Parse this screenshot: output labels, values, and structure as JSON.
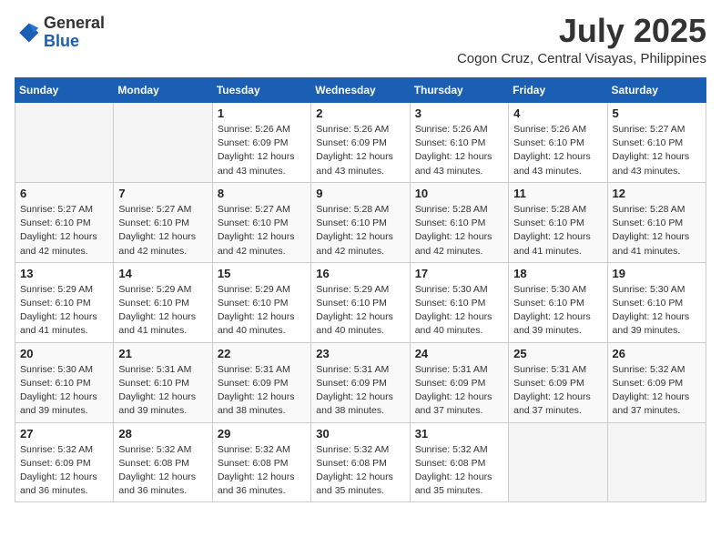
{
  "header": {
    "logo_line1": "General",
    "logo_line2": "Blue",
    "month_title": "July 2025",
    "location": "Cogon Cruz, Central Visayas, Philippines"
  },
  "days_of_week": [
    "Sunday",
    "Monday",
    "Tuesday",
    "Wednesday",
    "Thursday",
    "Friday",
    "Saturday"
  ],
  "weeks": [
    [
      {
        "day": "",
        "sunrise": "",
        "sunset": "",
        "daylight": "",
        "empty": true
      },
      {
        "day": "",
        "sunrise": "",
        "sunset": "",
        "daylight": "",
        "empty": true
      },
      {
        "day": "1",
        "sunrise": "Sunrise: 5:26 AM",
        "sunset": "Sunset: 6:09 PM",
        "daylight": "Daylight: 12 hours and 43 minutes."
      },
      {
        "day": "2",
        "sunrise": "Sunrise: 5:26 AM",
        "sunset": "Sunset: 6:09 PM",
        "daylight": "Daylight: 12 hours and 43 minutes."
      },
      {
        "day": "3",
        "sunrise": "Sunrise: 5:26 AM",
        "sunset": "Sunset: 6:10 PM",
        "daylight": "Daylight: 12 hours and 43 minutes."
      },
      {
        "day": "4",
        "sunrise": "Sunrise: 5:26 AM",
        "sunset": "Sunset: 6:10 PM",
        "daylight": "Daylight: 12 hours and 43 minutes."
      },
      {
        "day": "5",
        "sunrise": "Sunrise: 5:27 AM",
        "sunset": "Sunset: 6:10 PM",
        "daylight": "Daylight: 12 hours and 43 minutes."
      }
    ],
    [
      {
        "day": "6",
        "sunrise": "Sunrise: 5:27 AM",
        "sunset": "Sunset: 6:10 PM",
        "daylight": "Daylight: 12 hours and 42 minutes."
      },
      {
        "day": "7",
        "sunrise": "Sunrise: 5:27 AM",
        "sunset": "Sunset: 6:10 PM",
        "daylight": "Daylight: 12 hours and 42 minutes."
      },
      {
        "day": "8",
        "sunrise": "Sunrise: 5:27 AM",
        "sunset": "Sunset: 6:10 PM",
        "daylight": "Daylight: 12 hours and 42 minutes."
      },
      {
        "day": "9",
        "sunrise": "Sunrise: 5:28 AM",
        "sunset": "Sunset: 6:10 PM",
        "daylight": "Daylight: 12 hours and 42 minutes."
      },
      {
        "day": "10",
        "sunrise": "Sunrise: 5:28 AM",
        "sunset": "Sunset: 6:10 PM",
        "daylight": "Daylight: 12 hours and 42 minutes."
      },
      {
        "day": "11",
        "sunrise": "Sunrise: 5:28 AM",
        "sunset": "Sunset: 6:10 PM",
        "daylight": "Daylight: 12 hours and 41 minutes."
      },
      {
        "day": "12",
        "sunrise": "Sunrise: 5:28 AM",
        "sunset": "Sunset: 6:10 PM",
        "daylight": "Daylight: 12 hours and 41 minutes."
      }
    ],
    [
      {
        "day": "13",
        "sunrise": "Sunrise: 5:29 AM",
        "sunset": "Sunset: 6:10 PM",
        "daylight": "Daylight: 12 hours and 41 minutes."
      },
      {
        "day": "14",
        "sunrise": "Sunrise: 5:29 AM",
        "sunset": "Sunset: 6:10 PM",
        "daylight": "Daylight: 12 hours and 41 minutes."
      },
      {
        "day": "15",
        "sunrise": "Sunrise: 5:29 AM",
        "sunset": "Sunset: 6:10 PM",
        "daylight": "Daylight: 12 hours and 40 minutes."
      },
      {
        "day": "16",
        "sunrise": "Sunrise: 5:29 AM",
        "sunset": "Sunset: 6:10 PM",
        "daylight": "Daylight: 12 hours and 40 minutes."
      },
      {
        "day": "17",
        "sunrise": "Sunrise: 5:30 AM",
        "sunset": "Sunset: 6:10 PM",
        "daylight": "Daylight: 12 hours and 40 minutes."
      },
      {
        "day": "18",
        "sunrise": "Sunrise: 5:30 AM",
        "sunset": "Sunset: 6:10 PM",
        "daylight": "Daylight: 12 hours and 39 minutes."
      },
      {
        "day": "19",
        "sunrise": "Sunrise: 5:30 AM",
        "sunset": "Sunset: 6:10 PM",
        "daylight": "Daylight: 12 hours and 39 minutes."
      }
    ],
    [
      {
        "day": "20",
        "sunrise": "Sunrise: 5:30 AM",
        "sunset": "Sunset: 6:10 PM",
        "daylight": "Daylight: 12 hours and 39 minutes."
      },
      {
        "day": "21",
        "sunrise": "Sunrise: 5:31 AM",
        "sunset": "Sunset: 6:10 PM",
        "daylight": "Daylight: 12 hours and 39 minutes."
      },
      {
        "day": "22",
        "sunrise": "Sunrise: 5:31 AM",
        "sunset": "Sunset: 6:09 PM",
        "daylight": "Daylight: 12 hours and 38 minutes."
      },
      {
        "day": "23",
        "sunrise": "Sunrise: 5:31 AM",
        "sunset": "Sunset: 6:09 PM",
        "daylight": "Daylight: 12 hours and 38 minutes."
      },
      {
        "day": "24",
        "sunrise": "Sunrise: 5:31 AM",
        "sunset": "Sunset: 6:09 PM",
        "daylight": "Daylight: 12 hours and 37 minutes."
      },
      {
        "day": "25",
        "sunrise": "Sunrise: 5:31 AM",
        "sunset": "Sunset: 6:09 PM",
        "daylight": "Daylight: 12 hours and 37 minutes."
      },
      {
        "day": "26",
        "sunrise": "Sunrise: 5:32 AM",
        "sunset": "Sunset: 6:09 PM",
        "daylight": "Daylight: 12 hours and 37 minutes."
      }
    ],
    [
      {
        "day": "27",
        "sunrise": "Sunrise: 5:32 AM",
        "sunset": "Sunset: 6:09 PM",
        "daylight": "Daylight: 12 hours and 36 minutes."
      },
      {
        "day": "28",
        "sunrise": "Sunrise: 5:32 AM",
        "sunset": "Sunset: 6:08 PM",
        "daylight": "Daylight: 12 hours and 36 minutes."
      },
      {
        "day": "29",
        "sunrise": "Sunrise: 5:32 AM",
        "sunset": "Sunset: 6:08 PM",
        "daylight": "Daylight: 12 hours and 36 minutes."
      },
      {
        "day": "30",
        "sunrise": "Sunrise: 5:32 AM",
        "sunset": "Sunset: 6:08 PM",
        "daylight": "Daylight: 12 hours and 35 minutes."
      },
      {
        "day": "31",
        "sunrise": "Sunrise: 5:32 AM",
        "sunset": "Sunset: 6:08 PM",
        "daylight": "Daylight: 12 hours and 35 minutes."
      },
      {
        "day": "",
        "sunrise": "",
        "sunset": "",
        "daylight": "",
        "empty": true
      },
      {
        "day": "",
        "sunrise": "",
        "sunset": "",
        "daylight": "",
        "empty": true
      }
    ]
  ]
}
